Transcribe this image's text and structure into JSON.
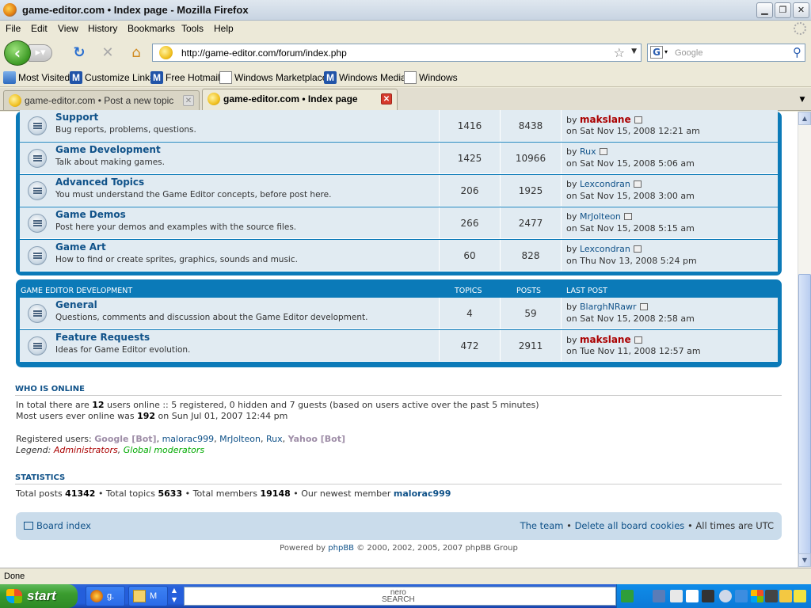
{
  "window": {
    "title": "game-editor.com • Index page - Mozilla Firefox"
  },
  "menu": [
    "File",
    "Edit",
    "View",
    "History",
    "Bookmarks",
    "Tools",
    "Help"
  ],
  "nav": {
    "url": "http://game-editor.com/forum/index.php",
    "search_placeholder": "Google"
  },
  "bookmarks": [
    "Most Visited",
    "Customize Links",
    "Free Hotmail",
    "Windows Marketplace",
    "Windows Media",
    "Windows"
  ],
  "tabs": [
    {
      "label": "game-editor.com • Post a new topic",
      "active": false
    },
    {
      "label": "game-editor.com • Index page",
      "active": true
    }
  ],
  "forums1": [
    {
      "title": "Support",
      "desc": "Bug reports, problems, questions.",
      "topics": "1416",
      "posts": "8438",
      "by_label": "by",
      "author": "makslane",
      "admin": true,
      "date": "on Sat Nov 15, 2008 12:21 am"
    },
    {
      "title": "Game Development",
      "desc": "Talk about making games.",
      "topics": "1425",
      "posts": "10966",
      "by_label": "by",
      "author": "Rux",
      "admin": false,
      "date": "on Sat Nov 15, 2008 5:06 am"
    },
    {
      "title": "Advanced Topics",
      "desc": "You must understand the Game Editor concepts, before post here.",
      "topics": "206",
      "posts": "1925",
      "by_label": "by",
      "author": "Lexcondran",
      "admin": false,
      "date": "on Sat Nov 15, 2008 3:00 am"
    },
    {
      "title": "Game Demos",
      "desc": "Post here your demos and examples with the source files.",
      "topics": "266",
      "posts": "2477",
      "by_label": "by",
      "author": "MrJolteon",
      "admin": false,
      "date": "on Sat Nov 15, 2008 5:15 am"
    },
    {
      "title": "Game Art",
      "desc": "How to find or create sprites, graphics, sounds and music.",
      "topics": "60",
      "posts": "828",
      "by_label": "by",
      "author": "Lexcondran",
      "admin": false,
      "date": "on Thu Nov 13, 2008 5:24 pm"
    }
  ],
  "section2": {
    "name": "GAME EDITOR DEVELOPMENT",
    "col_topics": "TOPICS",
    "col_posts": "POSTS",
    "col_last": "LAST POST"
  },
  "forums2": [
    {
      "title": "General",
      "desc": "Questions, comments and discussion about the Game Editor development.",
      "topics": "4",
      "posts": "59",
      "by_label": "by",
      "author": "BlarghNRawr",
      "admin": false,
      "date": "on Sat Nov 15, 2008 2:58 am"
    },
    {
      "title": "Feature Requests",
      "desc": "Ideas for Game Editor evolution.",
      "topics": "472",
      "posts": "2911",
      "by_label": "by",
      "author": "makslane",
      "admin": true,
      "date": "on Tue Nov 11, 2008 12:57 am"
    }
  ],
  "online": {
    "heading": "WHO IS ONLINE",
    "line1_a": "In total there are ",
    "line1_count": "12",
    "line1_b": " users online :: 5 registered, 0 hidden and 7 guests (based on users active over the past 5 minutes)",
    "line2_a": "Most users ever online was ",
    "line2_count": "192",
    "line2_b": " on Sun Jul 01, 2007 12:44 pm",
    "registered_label": "Registered users: ",
    "users": [
      {
        "name": "Google [Bot]",
        "type": "bot"
      },
      {
        "name": "malorac999",
        "type": "usr"
      },
      {
        "name": "MrJolteon",
        "type": "usr"
      },
      {
        "name": "Rux",
        "type": "usr"
      },
      {
        "name": "Yahoo [Bot]",
        "type": "bot"
      }
    ],
    "legend_label": "Legend: ",
    "legend_admin": "Administrators",
    "legend_mod": "Global moderators"
  },
  "stats": {
    "heading": "STATISTICS",
    "total_posts_label": "Total posts ",
    "total_posts": "41342",
    "total_topics_label": " • Total topics ",
    "total_topics": "5633",
    "total_members_label": " • Total members ",
    "total_members": "19148",
    "newest_label": " • Our newest member ",
    "newest": "malorac999"
  },
  "footer": {
    "board_index": "Board index",
    "team": "The team",
    "delete_cookies": "Delete all board cookies",
    "times": "All times are UTC",
    "powered_a": "Powered by ",
    "powered_link": "phpBB",
    "powered_b": " © 2000, 2002, 2005, 2007 phpBB Group"
  },
  "status": "Done",
  "taskbar": {
    "start": "start",
    "items": [
      "g.",
      "M"
    ],
    "nero": "nero\nSEARCH"
  }
}
